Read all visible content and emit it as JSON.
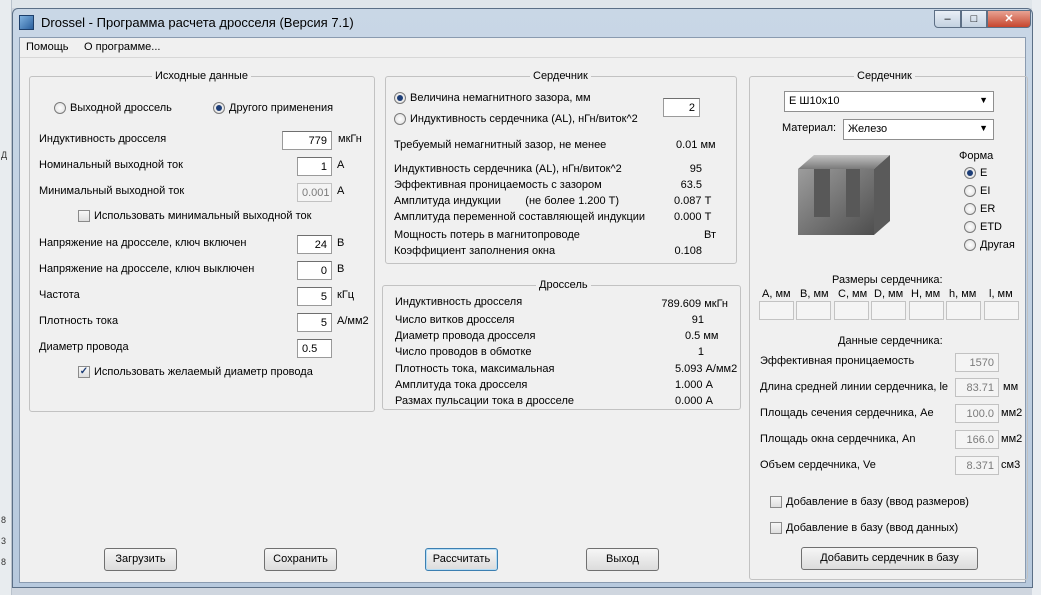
{
  "window": {
    "title": "Drossel - Программа расчета дросселя (Версия 7.1)"
  },
  "menu": [
    "Помощь",
    "О программе..."
  ],
  "input_group": {
    "title": "Исходные данные",
    "radio_output": "Выходной дроссель",
    "radio_other": "Другого применения",
    "selected_radio": "other",
    "rows": [
      {
        "label": "Индуктивность  дросселя",
        "value": "779",
        "unit": "мкГн",
        "disabled": false
      },
      {
        "label": "Номинальный выходной ток",
        "value": "1",
        "unit": "А",
        "disabled": false
      },
      {
        "label": "Минимальный выходной ток",
        "value": "0.001",
        "unit": "А",
        "disabled": true
      },
      {
        "label": "Напряжение на дросселе, ключ включен",
        "value": "24",
        "unit": "В",
        "disabled": false
      },
      {
        "label": "Напряжение на дросселе, ключ выключен",
        "value": "0",
        "unit": "В",
        "disabled": false
      },
      {
        "label": "Частота",
        "value": "5",
        "unit": "кГц",
        "disabled": false
      },
      {
        "label": "Плотность тока",
        "value": "5",
        "unit": "А/мм2",
        "disabled": false
      },
      {
        "label": "Диаметр провода",
        "value": "0.5",
        "unit": "",
        "disabled": false
      }
    ],
    "check_min_current": {
      "label": "Использовать минимальный выходной ток",
      "checked": false
    },
    "check_wire": {
      "label": "Использовать желаемый диаметр провода",
      "checked": true
    }
  },
  "core_calc_group": {
    "title": "Сердечник",
    "radio_gap": "Величина немагнитного зазора, мм",
    "radio_al": "Индуктивность сердечника (AL), нГн/виток^2",
    "selected_radio": "gap",
    "gap_value": "2",
    "rows": [
      {
        "label": "Требуемый немагнитный зазор, не менее",
        "value": "0.01 мм"
      },
      {
        "label": "Индуктивность сердечника (AL), нГн/виток^2",
        "value": "95"
      },
      {
        "label": "Эффективная проницаемость с зазором",
        "value": "63.5"
      },
      {
        "label": "Амплитуда индукции        (не более 1.200 Т)",
        "value": "0.087 Т"
      },
      {
        "label": "Амплитуда переменной составляющей индукции",
        "value": "0.000 Т"
      },
      {
        "label": "Мощность потерь в магнитопроводе",
        "value": "Вт"
      },
      {
        "label": "Коэффициент заполнения окна",
        "value": "0.108"
      }
    ]
  },
  "choke_group": {
    "title": "Дроссель",
    "rows": [
      {
        "label": "Индуктивность дросселя",
        "value": "789.609 мкГн"
      },
      {
        "label": "Число витков дросселя",
        "value": "91"
      },
      {
        "label": "Диаметр провода дросселя",
        "value": "0.5 мм"
      },
      {
        "label": "Число проводов в обмотке",
        "value": "1"
      },
      {
        "label": "Плотность тока, максимальная",
        "value": "5.093 А/мм2"
      },
      {
        "label": "Амплитуда тока дросселя",
        "value": "1.000 А"
      },
      {
        "label": "Размах пульсации тока в дросселе",
        "value": "0.000 А"
      }
    ]
  },
  "core_select_group": {
    "title": "Сердечник",
    "core_combo": "Е Ш10х10",
    "material_label": "Материал:",
    "material_combo": "Железо",
    "form_title": "Форма",
    "forms": [
      "E",
      "EI",
      "ER",
      "ETD",
      "Другая"
    ],
    "selected_form": "E",
    "dims_title": "Размеры сердечника:",
    "dims": [
      "A, мм",
      "B, мм",
      "C, мм",
      "D, мм",
      "H, мм",
      "h, мм",
      "l, мм"
    ],
    "data_title": "Данные сердечника:",
    "data_rows": [
      {
        "label": "Эффективная проницаемость",
        "value": "1570",
        "unit": ""
      },
      {
        "label": "Длина средней линии сердечника, le",
        "value": "83.71",
        "unit": "мм"
      },
      {
        "label": "Площадь сечения сердечника, Ae",
        "value": "100.0",
        "unit": "мм2"
      },
      {
        "label": "Площадь окна сердечника, An",
        "value": "166.0",
        "unit": "мм2"
      },
      {
        "label": "Объем сердечника, Ve",
        "value": "8.371",
        "unit": "см3"
      }
    ],
    "check_add_dims": "Добавление в базу (ввод размеров)",
    "check_add_data": "Добавление в базу (ввод данных)",
    "add_button": "Добавить сердечник в базу"
  },
  "buttons": {
    "load": "Загрузить",
    "save": "Сохранить",
    "calculate": "Рассчитать",
    "exit": "Выход"
  },
  "desktop_fragments": [
    "Д",
    "8",
    "3",
    "8"
  ],
  "window_controls": {
    "min": "‒",
    "max": "□",
    "close": "✕"
  }
}
